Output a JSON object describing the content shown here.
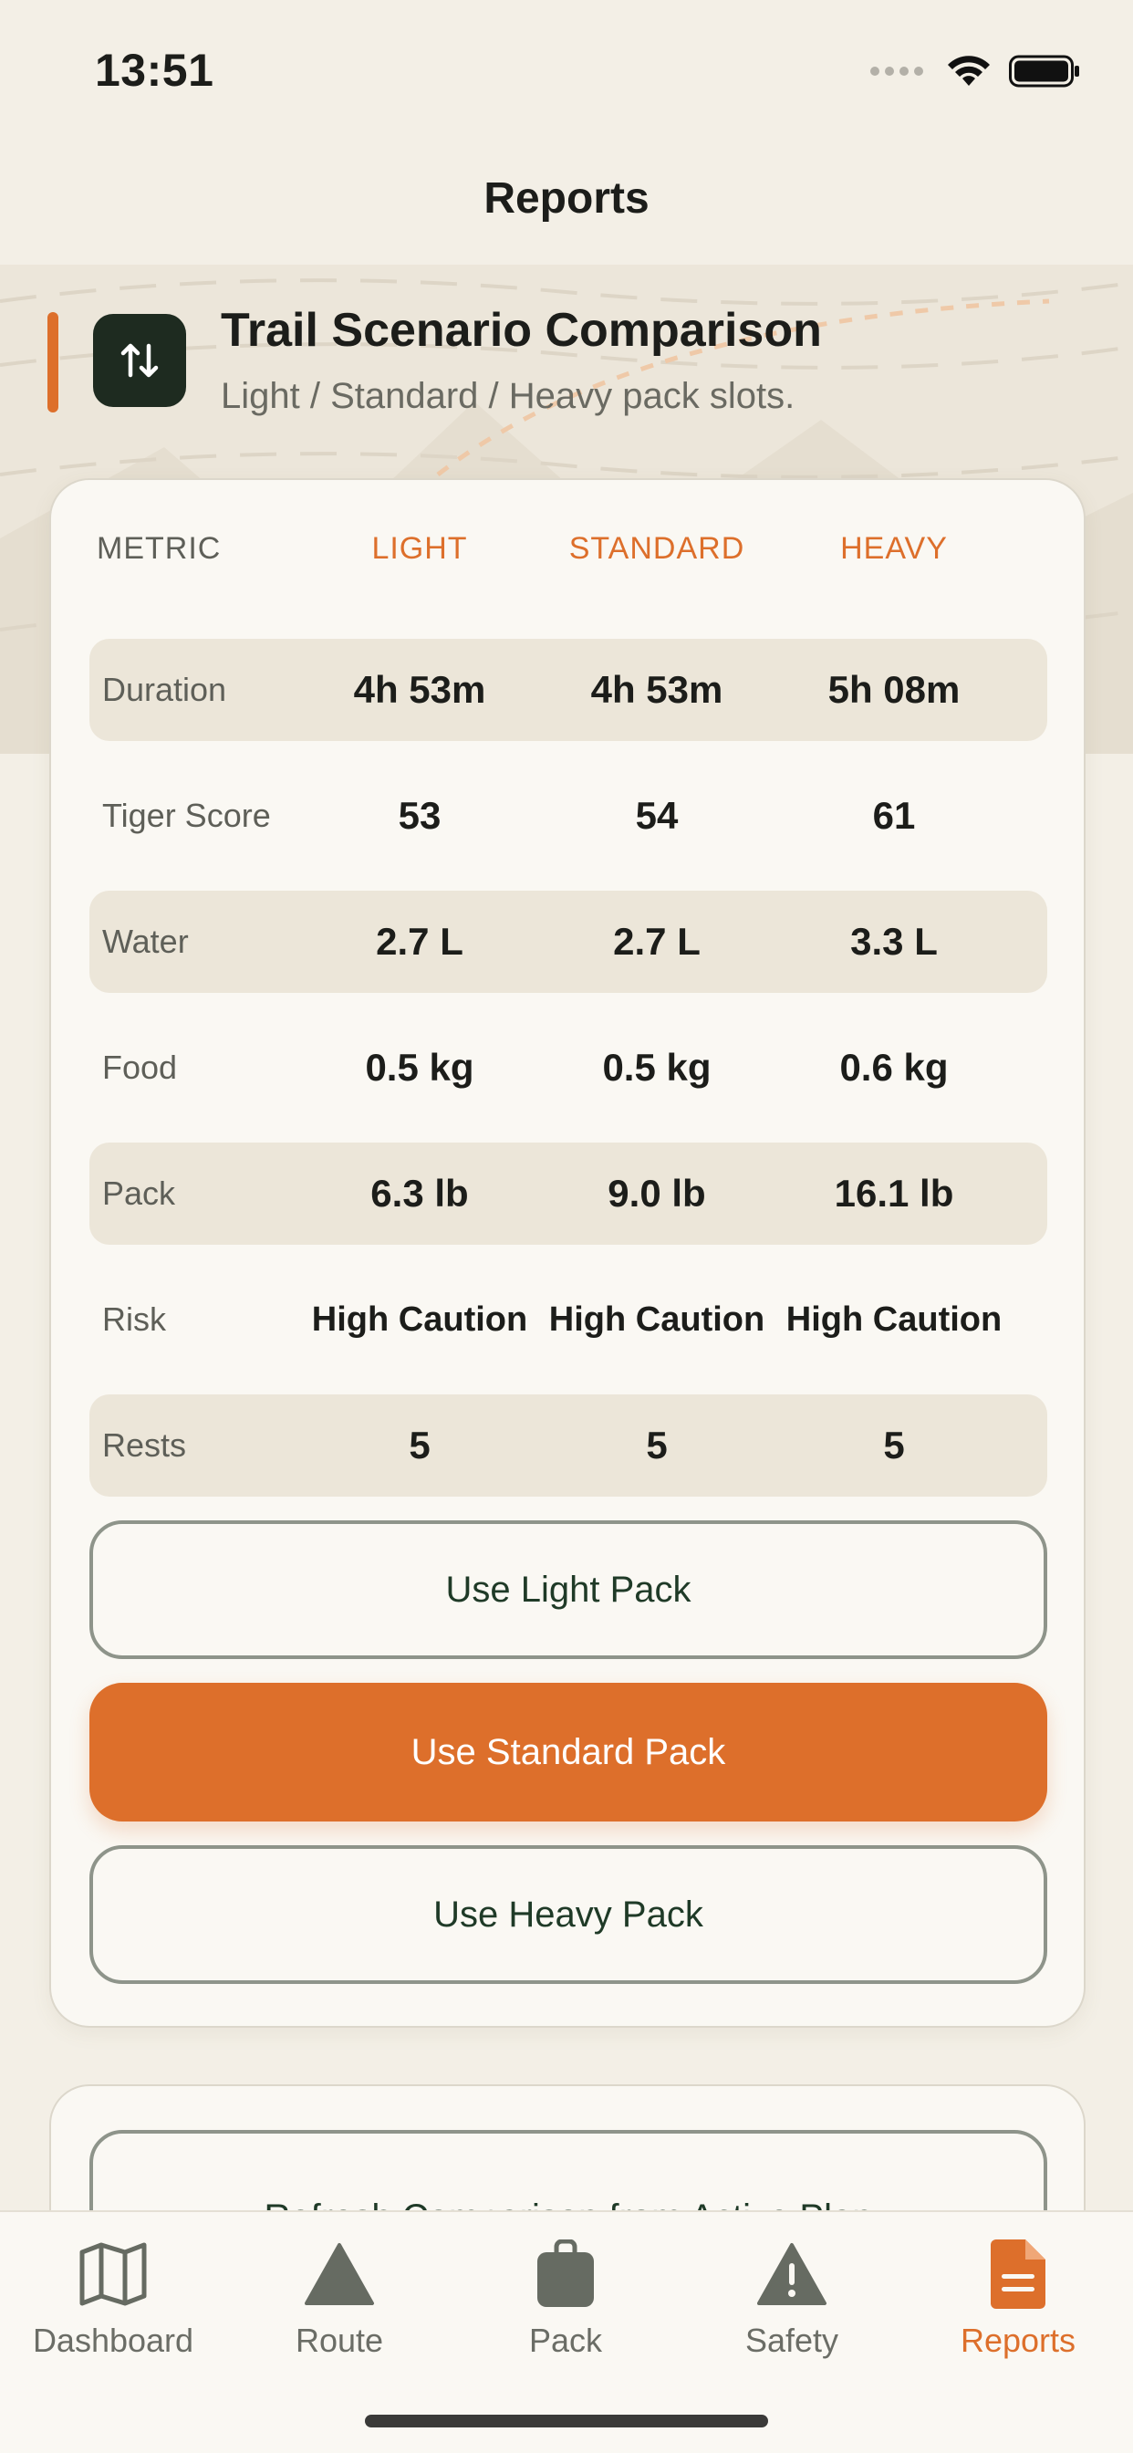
{
  "status_bar": {
    "time": "13:51"
  },
  "nav": {
    "title": "Reports"
  },
  "section": {
    "title": "Trail Scenario Comparison",
    "subtitle": "Light / Standard / Heavy pack slots."
  },
  "table": {
    "headers": {
      "metric": "METRIC",
      "light": "LIGHT",
      "standard": "STANDARD",
      "heavy": "HEAVY"
    },
    "rows": [
      {
        "label": "Duration",
        "light": "4h 53m",
        "standard": "4h 53m",
        "heavy": "5h 08m"
      },
      {
        "label": "Tiger Score",
        "light": "53",
        "standard": "54",
        "heavy": "61"
      },
      {
        "label": "Water",
        "light": "2.7 L",
        "standard": "2.7 L",
        "heavy": "3.3 L"
      },
      {
        "label": "Food",
        "light": "0.5 kg",
        "standard": "0.5 kg",
        "heavy": "0.6 kg"
      },
      {
        "label": "Pack",
        "light": "6.3 lb",
        "standard": "9.0 lb",
        "heavy": "16.1 lb"
      },
      {
        "label": "Risk",
        "light": "High Caution",
        "standard": "High Caution",
        "heavy": "High Caution"
      },
      {
        "label": "Rests",
        "light": "5",
        "standard": "5",
        "heavy": "5"
      }
    ]
  },
  "actions": {
    "use_light": "Use Light Pack",
    "use_standard": "Use Standard Pack",
    "use_heavy": "Use Heavy Pack",
    "refresh": "Refresh Comparison from Active Plan"
  },
  "tabs": [
    {
      "label": "Dashboard",
      "icon": "map-icon",
      "active": false
    },
    {
      "label": "Route",
      "icon": "mountain-icon",
      "active": false
    },
    {
      "label": "Pack",
      "icon": "backpack-icon",
      "active": false
    },
    {
      "label": "Safety",
      "icon": "warning-icon",
      "active": false
    },
    {
      "label": "Reports",
      "icon": "document-icon",
      "active": true
    }
  ],
  "colors": {
    "accent": "#dd6f2b",
    "dark_green": "#1e2b20",
    "background": "#f3efe6"
  }
}
